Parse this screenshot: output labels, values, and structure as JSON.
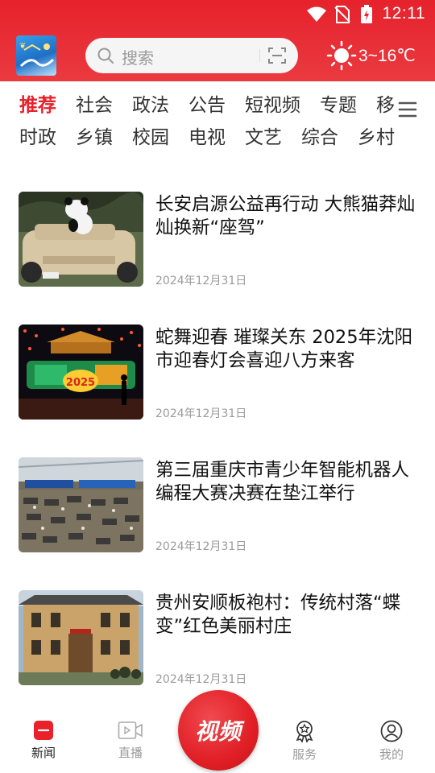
{
  "status_bar": {
    "time": "12:11"
  },
  "search": {
    "placeholder": "搜索"
  },
  "weather": {
    "temperature": "3~16℃",
    "icon": "sun-icon"
  },
  "tabs": {
    "row1": [
      {
        "label": "推荐",
        "active": true
      },
      {
        "label": "社会"
      },
      {
        "label": "政法"
      },
      {
        "label": "公告"
      },
      {
        "label": "短视频"
      },
      {
        "label": "专题"
      },
      {
        "label": "移"
      }
    ],
    "row2": [
      {
        "label": "时政"
      },
      {
        "label": "乡镇"
      },
      {
        "label": "校园"
      },
      {
        "label": "电视"
      },
      {
        "label": "文艺"
      },
      {
        "label": "综合"
      },
      {
        "label": "乡村"
      }
    ]
  },
  "news": [
    {
      "title": "长安启源公益再行动 大熊猫莽灿灿换新“座驾”",
      "date": "2024年12月31日"
    },
    {
      "title": "蛇舞迎春 璀璨关东 2025年沈阳市迎春灯会喜迎八方来客",
      "date": "2024年12月31日"
    },
    {
      "title": "第三届重庆市青少年智能机器人编程大赛决赛在垫江举行",
      "date": "2024年12月31日"
    },
    {
      "title": "贵州安顺板袍村：传统村落“蝶变”红色美丽村庄",
      "date": "2024年12月31日"
    }
  ],
  "bottom_nav": {
    "news": "新闻",
    "live": "直播",
    "video": "视频",
    "service": "服务",
    "mine": "我的"
  },
  "colors": {
    "brand": "#e6222c",
    "text": "#111111",
    "muted": "#9b9b9b"
  }
}
